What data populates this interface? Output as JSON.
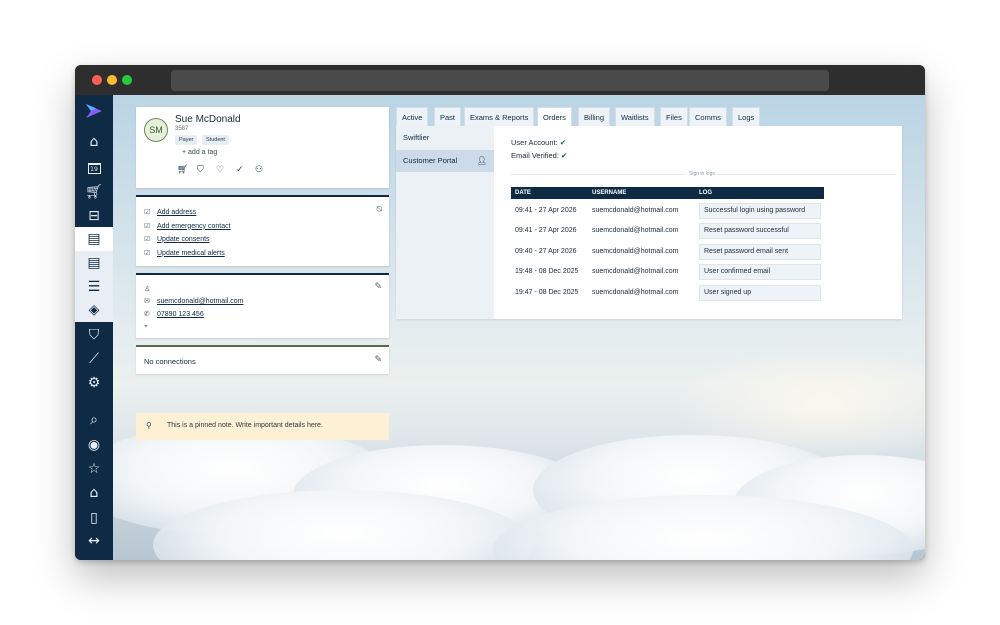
{
  "profile": {
    "initials": "SM",
    "name": "Sue McDonald",
    "id": "3587",
    "tags": [
      "Payer",
      "Student"
    ],
    "add_tag": "+ add a tag"
  },
  "links": [
    "Add address",
    "Add emergency contact",
    "Update consents",
    "Update medical alerts"
  ],
  "contact": {
    "email": "suemcdonald@hotmail.com",
    "phone": "07890 123 456"
  },
  "connections": "No connections",
  "pinned_note": "This is a pinned note. Write important details here.",
  "tabs": [
    "Active",
    "Past",
    "Exams & Reports",
    "Orders",
    "Billing",
    "Waitlists",
    "Files",
    "Comms",
    "Logs"
  ],
  "active_tab": "Orders",
  "subnav": [
    "Swiftlier",
    "Customer Portal"
  ],
  "account": {
    "user_account_label": "User Account:",
    "email_verified_label": "Email Verified:"
  },
  "signin_label": "Sign in logs",
  "table": {
    "headers": [
      "DATE",
      "USERNAME",
      "LOG"
    ],
    "rows": [
      [
        "09:41 - 27 Apr 2026",
        "suemcdonald@hotmail.com",
        "Successful login using password"
      ],
      [
        "09:41 - 27 Apr 2026",
        "suemcdonald@hotmail.com",
        "Reset password successful"
      ],
      [
        "09:40 - 27 Apr 2026",
        "suemcdonald@hotmail.com",
        "Reset password email sent"
      ],
      [
        "19:48 - 08 Dec 2025",
        "suemcdonald@hotmail.com",
        "User confirmed email"
      ],
      [
        "19:47 - 08 Dec 2025",
        "suemcdonald@hotmail.com",
        "User signed up"
      ]
    ]
  },
  "icons": {
    "nav": [
      "home-icon",
      "calendar-icon",
      "cart-icon",
      "inbox-icon",
      "id-card-icon",
      "contact-card-icon",
      "list-icon",
      "alert-diamond-icon",
      "graduation-cap-icon",
      "chart-icon",
      "settings-icon",
      "search-icon",
      "user-circle-icon",
      "star-icon",
      "building-icon",
      "door-icon",
      "expand-arrows-icon"
    ],
    "calendar_number": "19"
  },
  "colors": {
    "sidebar": "#0f2a44",
    "accent_green": "#1e6b3a",
    "note_bg": "#fdf0d5"
  }
}
